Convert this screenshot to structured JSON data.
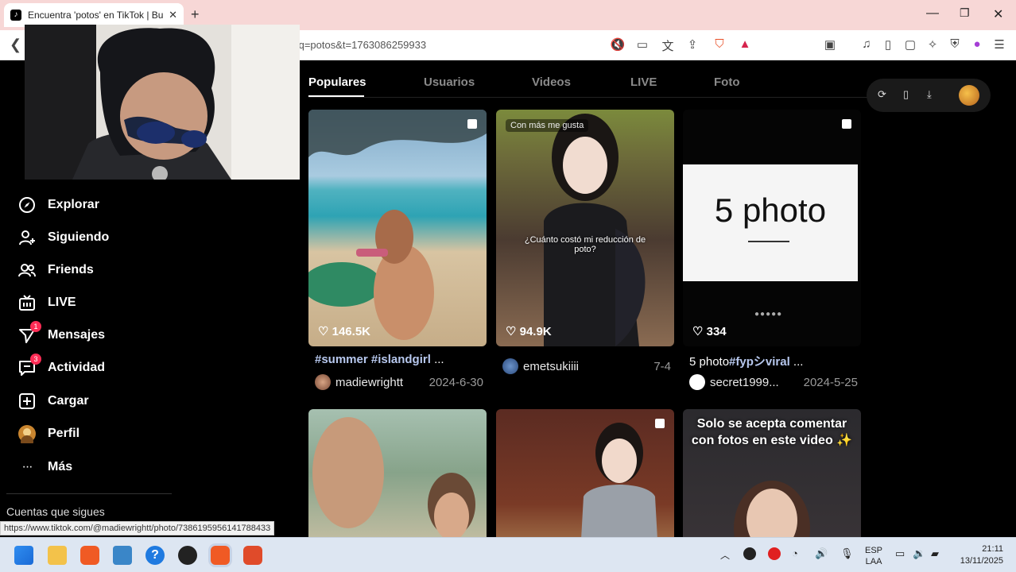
{
  "browser": {
    "tab_title": "Encuentra 'potos' en TikTok | Bu...",
    "tab_favicon": "tiktok-icon",
    "url_text": "/q=potos&t=1763086259933",
    "status_url": "https://www.tiktok.com/@madiewrightt/photo/7386195956141788433",
    "window_controls": [
      "minimize",
      "restore",
      "close"
    ],
    "toolbar_icons": [
      "no-sound-icon",
      "cast-icon",
      "translate-icon",
      "share-icon",
      "brave-shields-icon",
      "brave-rewards-icon",
      "reader-icon",
      "music-icon",
      "sidebar-icon",
      "wallet-icon",
      "leo-icon",
      "vpn-icon",
      "profile-icon",
      "menu-icon"
    ]
  },
  "sidebar": {
    "items": [
      {
        "label": "Explorar",
        "icon": "compass-icon"
      },
      {
        "label": "Siguiendo",
        "icon": "user-follow-icon"
      },
      {
        "label": "Friends",
        "icon": "friends-icon"
      },
      {
        "label": "LIVE",
        "icon": "live-tv-icon"
      },
      {
        "label": "Mensajes",
        "icon": "paper-plane-icon",
        "badge": "1"
      },
      {
        "label": "Actividad",
        "icon": "message-icon",
        "badge": "3"
      },
      {
        "label": "Cargar",
        "icon": "plus-square-icon"
      },
      {
        "label": "Perfil",
        "icon": "avatar-icon"
      },
      {
        "label": "Más",
        "icon": "more-icon"
      }
    ],
    "cuentas": "Cuentas que sigues"
  },
  "search_tabs": [
    "Populares",
    "Usuarios",
    "Videos",
    "LIVE",
    "Foto"
  ],
  "active_tab": "Populares",
  "results": [
    {
      "likes": "146.5K",
      "desc_prefix": "",
      "desc_tags": "#summer #islandgirl",
      "desc_suffix": " ...",
      "user": "madiewrightt",
      "date": "2024-6-30"
    },
    {
      "likes": "94.9K",
      "overlay_text": "¿Cuánto costó mi reducción de poto?",
      "badge": "Con más me gusta",
      "desc_prefix": "",
      "desc_tags": "",
      "desc_suffix": "",
      "user": "emetsukiiii",
      "date": "7-4"
    },
    {
      "likes": "334",
      "overlay_text": "5 photo",
      "desc_prefix": "5 photo",
      "desc_tags": "#fypシviral",
      "desc_suffix": " ...",
      "user": "secret1999...",
      "date": "2024-5-25"
    },
    {
      "overlay_text": ""
    },
    {
      "overlay_text": ""
    },
    {
      "overlay_text": "Solo se acepta comentar con fotos en este video ✨"
    }
  ],
  "taskbar": {
    "lang1": "ESP",
    "lang2": "LAA",
    "time": "21:11",
    "date": "13/11/2025"
  }
}
